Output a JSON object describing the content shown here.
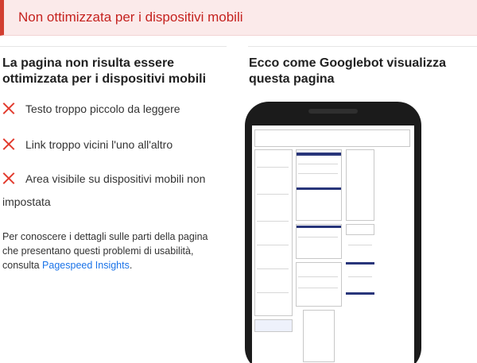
{
  "banner": {
    "title": "Non ottimizzata per i dispositivi mobili"
  },
  "left": {
    "heading": "La pagina non risulta essere ottimizzata per i dispositivi mobili",
    "issues": [
      {
        "icon": "error-x-icon",
        "text": "Testo troppo piccolo da leggere"
      },
      {
        "icon": "error-x-icon",
        "text": "Link troppo vicini l'uno all'altro"
      },
      {
        "icon": "error-x-icon",
        "text_line1": "Area visibile su dispositivi mobili non",
        "text_line2": "impostata"
      }
    ],
    "note_text": "Per conoscere i dettagli sulle parti della pagina che presentano questi problemi di usabilità, consulta",
    "note_link": "Pagespeed Insights",
    "note_end": "."
  },
  "right": {
    "heading": "Ecco come Googlebot visualizza questa pagina"
  },
  "colors": {
    "banner_bg": "#fbeaea",
    "banner_accent": "#d23f31",
    "error_red": "#e23b2e",
    "link_blue": "#1a73e8"
  }
}
